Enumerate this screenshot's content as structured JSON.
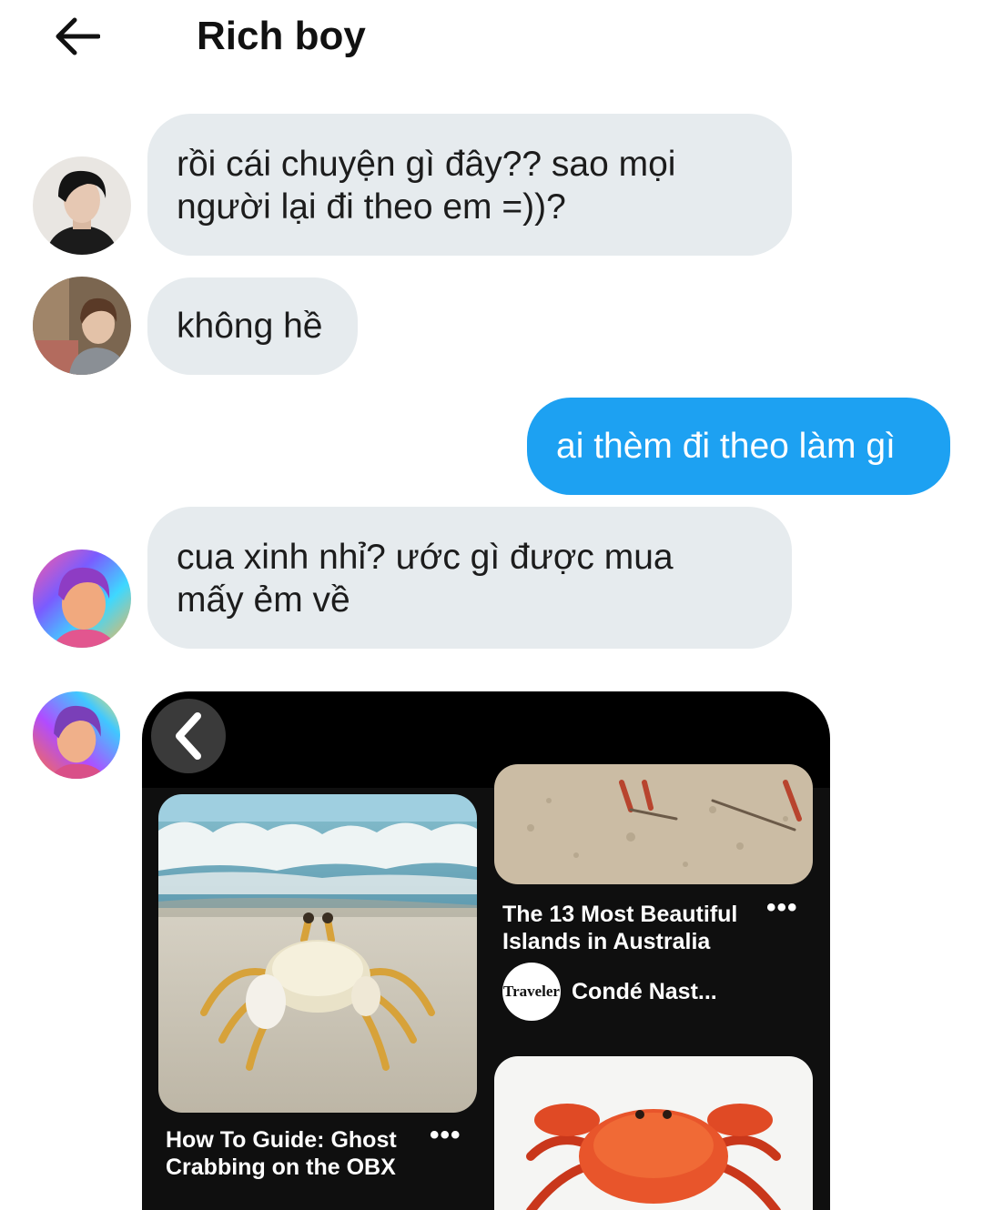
{
  "header": {
    "title": "Rich boy",
    "back_icon": "arrow-left-icon"
  },
  "messages": [
    {
      "direction": "incoming",
      "avatar": "avatar-1",
      "lines": [
        "rồi cái chuyện gì đây?? sao mọi",
        "người lại đi theo em =))?"
      ]
    },
    {
      "direction": "incoming",
      "avatar": "avatar-2",
      "lines": [
        "không hề"
      ]
    },
    {
      "direction": "outgoing",
      "lines": [
        "ai thèm đi theo làm gì"
      ]
    },
    {
      "direction": "incoming",
      "avatar": "avatar-3",
      "lines": [
        "cua xinh nhỉ? ước gì được mua",
        "mấy ẻm về"
      ]
    }
  ],
  "shared_card": {
    "back_icon": "chevron-left-icon",
    "pins": [
      {
        "title_lines": [
          "How To Guide: Ghost",
          "Crabbing on the OBX"
        ],
        "more": "•••"
      },
      {
        "title_lines": [
          "The 13 Most Beautiful",
          "Islands in Australia"
        ],
        "more": "•••",
        "source_logo": "Traveler",
        "source_name": "Condé Nast..."
      }
    ]
  },
  "colors": {
    "incoming_bubble": "#e6ebee",
    "outgoing_bubble": "#1da1f2",
    "card_background": "#000000"
  }
}
